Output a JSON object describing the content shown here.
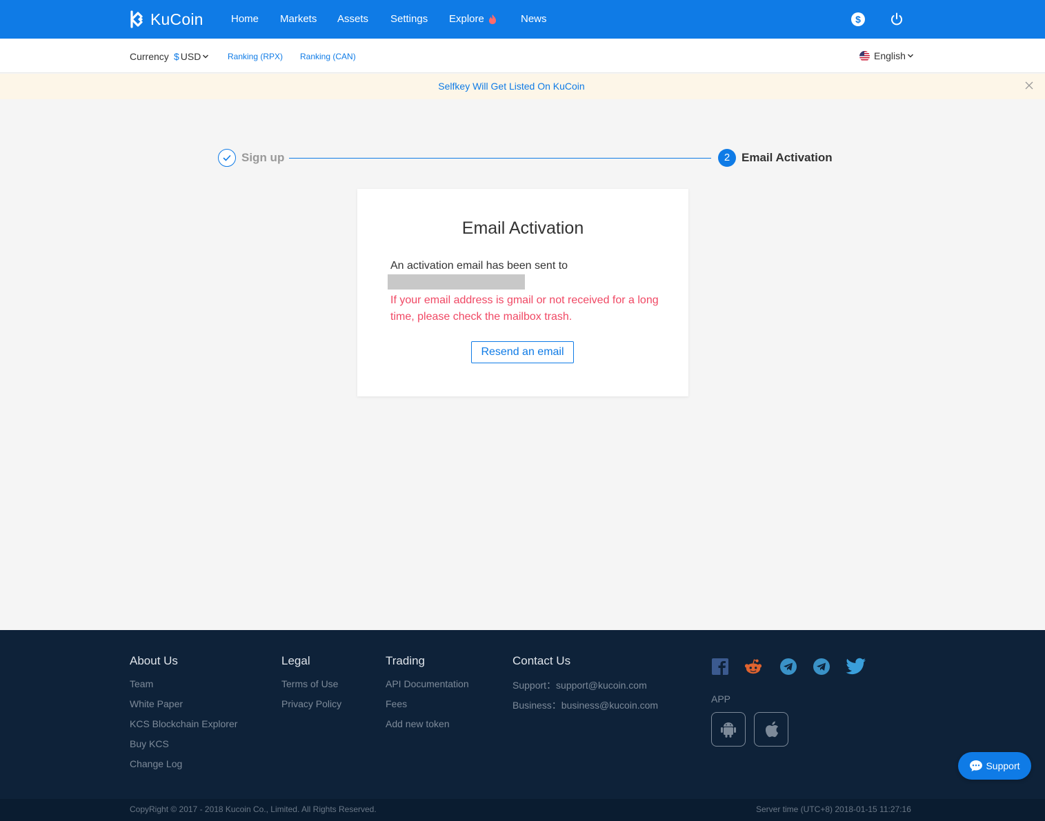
{
  "brand": {
    "name": "KuCoin"
  },
  "nav": {
    "items": [
      "Home",
      "Markets",
      "Assets",
      "Settings",
      "Explore",
      "News"
    ]
  },
  "subbar": {
    "currency_label": "Currency",
    "currency_symbol": "$",
    "currency_value": "USD",
    "ranking_rpx": "Ranking (RPX)",
    "ranking_can": "Ranking (CAN)",
    "language": "English"
  },
  "announcement": {
    "text": "Selfkey Will Get Listed On KuCoin"
  },
  "steps": {
    "step1_label": "Sign up",
    "step2_number": "2",
    "step2_label": "Email Activation"
  },
  "card": {
    "title": "Email Activation",
    "sent_text": "An activation email has been sent to",
    "warning": "If your email address is gmail or not received for a long time, please check the mailbox trash.",
    "resend_label": "Resend an email"
  },
  "footer": {
    "about": {
      "heading": "About Us",
      "links": [
        "Team",
        "White Paper",
        "KCS Blockchain Explorer",
        "Buy KCS",
        "Change Log"
      ]
    },
    "legal": {
      "heading": "Legal",
      "links": [
        "Terms of Use",
        "Privacy Policy"
      ]
    },
    "trading": {
      "heading": "Trading",
      "links": [
        "API Documentation",
        "Fees",
        "Add new token"
      ]
    },
    "contact": {
      "heading": "Contact Us",
      "support": "Support：support@kucoin.com",
      "business": "Business：business@kucoin.com"
    },
    "app_label": "APP",
    "copyright": "CopyRight © 2017 - 2018 Kucoin Co., Limited. All Rights Reserved.",
    "server_time": "Server time (UTC+8) 2018-01-15 11:27:16"
  },
  "support_widget": {
    "label": "Support"
  },
  "colors": {
    "primary": "#0f7be6",
    "warning": "#f04864",
    "footer_bg": "#0e2239",
    "announce_bg": "#fdf6e8"
  }
}
